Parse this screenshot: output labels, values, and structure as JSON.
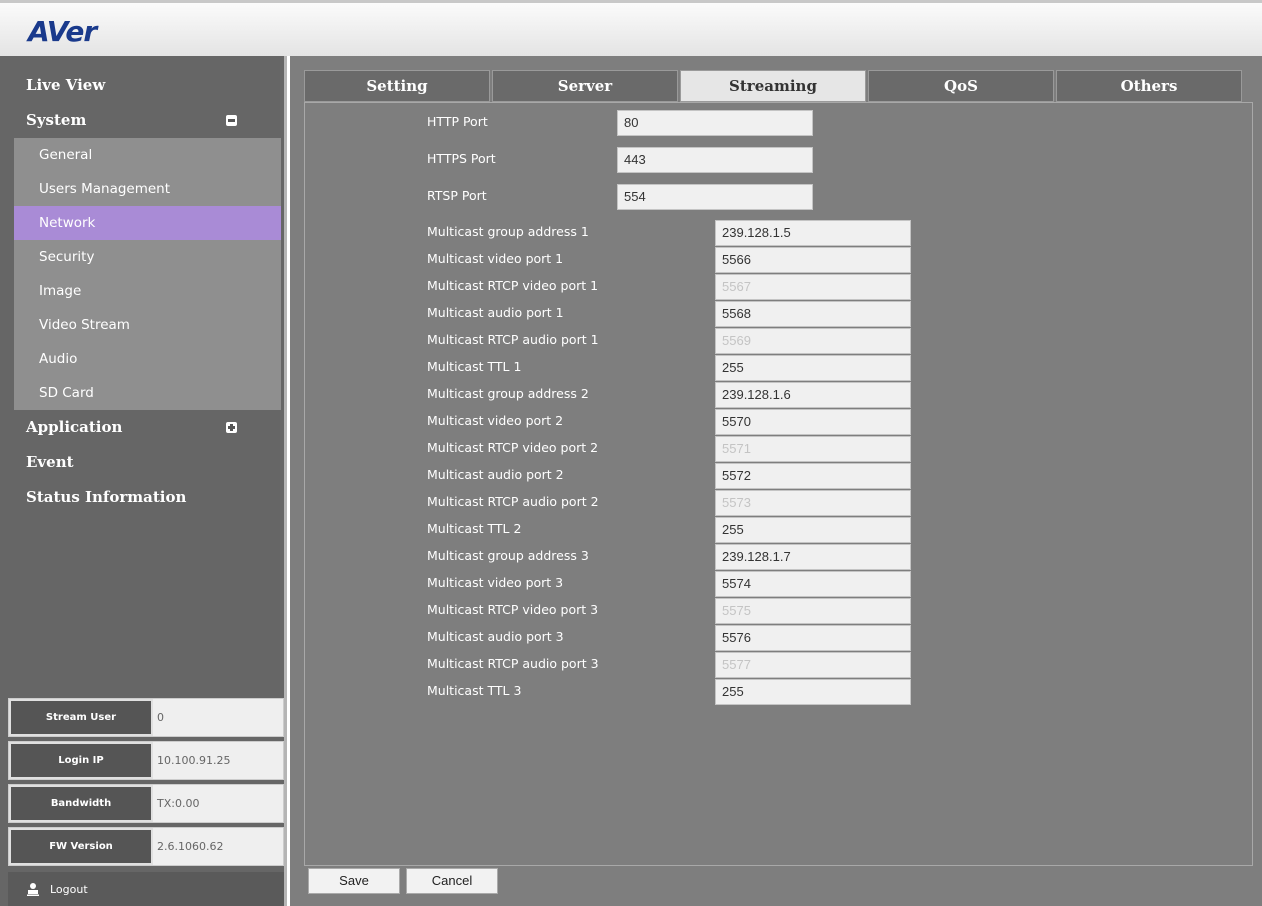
{
  "header": {
    "logo_text": "AVer"
  },
  "sidebar": {
    "live_view": "Live View",
    "system": "System",
    "system_sub": [
      {
        "label": "General"
      },
      {
        "label": "Users Management"
      },
      {
        "label": "Network"
      },
      {
        "label": "Security"
      },
      {
        "label": "Image"
      },
      {
        "label": "Video Stream"
      },
      {
        "label": "Audio"
      },
      {
        "label": "SD Card"
      }
    ],
    "application": "Application",
    "event": "Event",
    "status_information": "Status Information",
    "active_item": "Network",
    "active_color": "#a98bd6"
  },
  "info": [
    {
      "label": "Stream User",
      "value": "0"
    },
    {
      "label": "Login IP",
      "value": "10.100.91.25"
    },
    {
      "label": "Bandwidth",
      "value": "TX:0.00"
    },
    {
      "label": "FW Version",
      "value": "2.6.1060.62"
    }
  ],
  "logout": {
    "label": "Logout",
    "icon": "user-icon"
  },
  "tabs": [
    {
      "label": "Setting"
    },
    {
      "label": "Server"
    },
    {
      "label": "Streaming"
    },
    {
      "label": "QoS"
    },
    {
      "label": "Others"
    }
  ],
  "active_tab": "Streaming",
  "ports": [
    {
      "label": "HTTP Port",
      "value": "80"
    },
    {
      "label": "HTTPS Port",
      "value": "443"
    },
    {
      "label": "RTSP Port",
      "value": "554"
    }
  ],
  "multicast": [
    {
      "label": "Multicast group address 1",
      "value": "239.128.1.5"
    },
    {
      "label": "Multicast video port 1",
      "value": "5566"
    },
    {
      "label": "Multicast RTCP video port 1",
      "value": "5567"
    },
    {
      "label": "Multicast audio port 1",
      "value": "5568"
    },
    {
      "label": "Multicast RTCP audio port 1",
      "value": "5569"
    },
    {
      "label": "Multicast TTL 1",
      "value": "255"
    },
    {
      "label": "Multicast group address 2",
      "value": "239.128.1.6"
    },
    {
      "label": "Multicast video port 2",
      "value": "5570"
    },
    {
      "label": "Multicast RTCP video port 2",
      "value": "5571"
    },
    {
      "label": "Multicast audio port 2",
      "value": "5572"
    },
    {
      "label": "Multicast RTCP audio port 2",
      "value": "5573"
    },
    {
      "label": "Multicast TTL 2",
      "value": "255"
    },
    {
      "label": "Multicast group address 3",
      "value": "239.128.1.7"
    },
    {
      "label": "Multicast video port 3",
      "value": "5574"
    },
    {
      "label": "Multicast RTCP video port 3",
      "value": "5575"
    },
    {
      "label": "Multicast audio port 3",
      "value": "5576"
    },
    {
      "label": "Multicast RTCP audio port 3",
      "value": "5577"
    },
    {
      "label": "Multicast TTL 3",
      "value": "255"
    }
  ],
  "buttons": {
    "save": "Save",
    "cancel": "Cancel"
  }
}
